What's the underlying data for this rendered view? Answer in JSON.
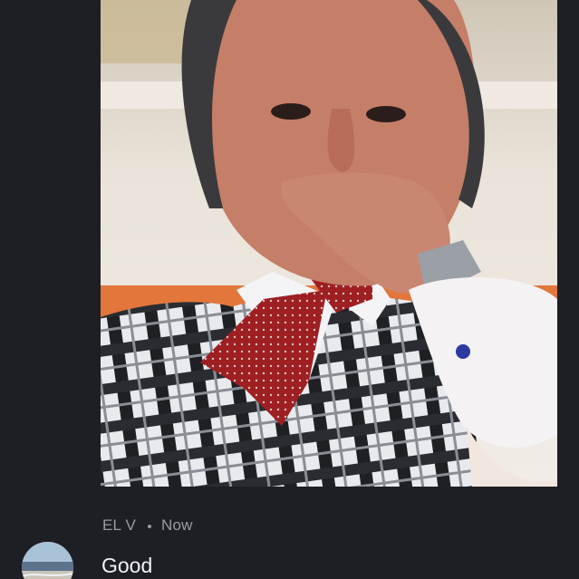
{
  "post": {
    "image_description_icon": "portrait-photo",
    "author": "EL V",
    "separator": "•",
    "time": "Now",
    "message": "Good"
  },
  "avatar": {
    "icon": "avatar-beach-photo"
  },
  "colors": {
    "background": "#1e1f24",
    "meta_text": "#9a9ba3",
    "message_text": "#f2f2f4"
  }
}
